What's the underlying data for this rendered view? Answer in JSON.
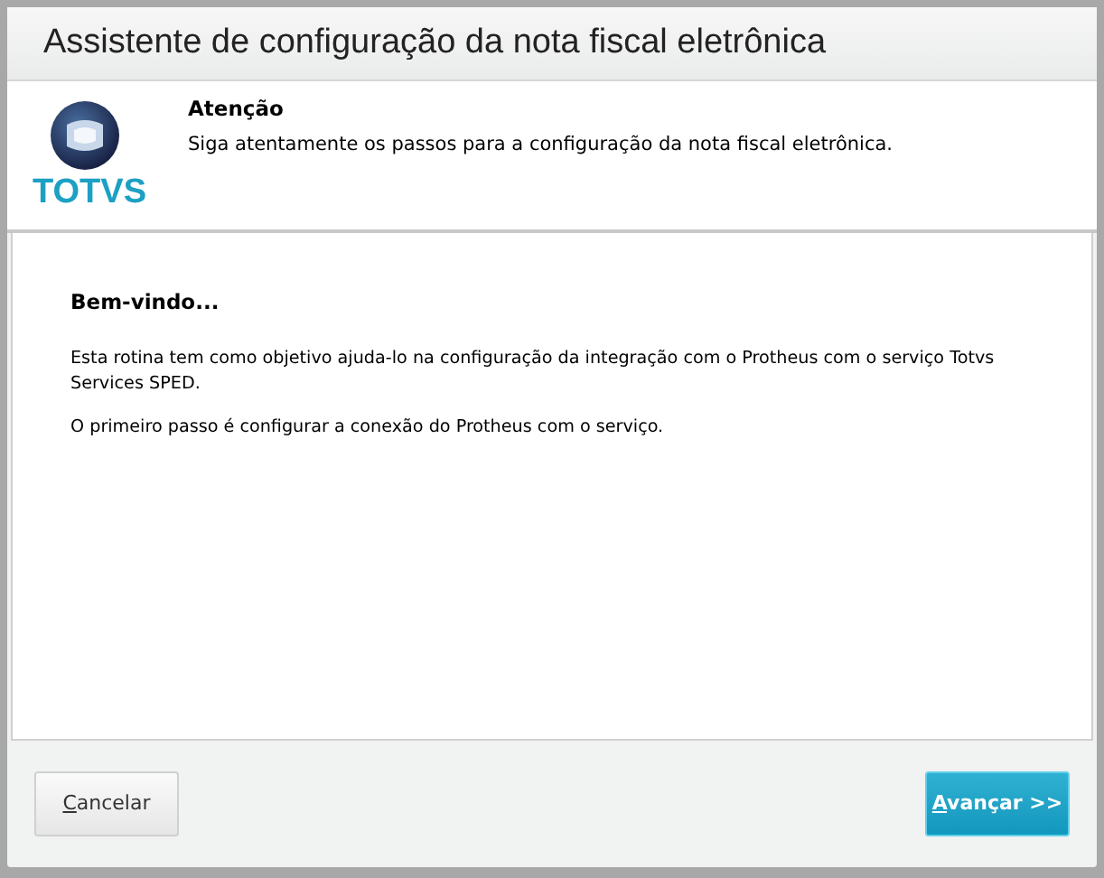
{
  "window": {
    "title": "Assistente de configuração da nota fiscal eletrônica"
  },
  "header": {
    "logo_text": "TOTVS",
    "heading": "Atenção",
    "subtitle": "Siga atentamente os passos para a configuração da nota fiscal eletrônica."
  },
  "content": {
    "heading": "Bem-vindo...",
    "paragraphs": [
      "Esta rotina tem como objetivo ajuda-lo na configuração da integração com o Protheus com o serviço Totvs Services SPED.",
      "O primeiro passo é configurar a conexão do Protheus com o serviço."
    ]
  },
  "buttons": [
    {
      "label": "Cancelar",
      "kind": "secondary"
    },
    {
      "label": "Avançar >>",
      "kind": "primary"
    }
  ]
}
